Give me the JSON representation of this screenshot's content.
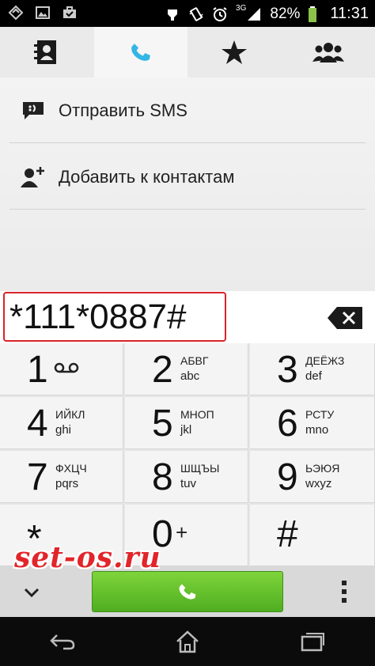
{
  "status_bar": {
    "left_icons": [
      "signal-strength-icon",
      "image-icon",
      "briefcase-icon"
    ],
    "right_icons": [
      "ring-icon",
      "vibrate-icon",
      "alarm-icon",
      "network-3g-icon",
      "battery-icon"
    ],
    "network": "3G",
    "battery": "82%",
    "time": "11:31"
  },
  "tabs": [
    {
      "name": "contacts",
      "icon": "contacts-icon"
    },
    {
      "name": "phone",
      "icon": "phone-icon",
      "active": true
    },
    {
      "name": "favorites",
      "icon": "star-icon"
    },
    {
      "name": "groups",
      "icon": "groups-icon"
    }
  ],
  "actions": {
    "send_sms": "Отправить SMS",
    "add_contact": "Добавить к контактам"
  },
  "dialer": {
    "number": "*111*0887#"
  },
  "keypad": [
    {
      "digit": "1",
      "sub1": "",
      "sub2": ""
    },
    {
      "digit": "2",
      "sub1": "АБВГ",
      "sub2": "abc"
    },
    {
      "digit": "3",
      "sub1": "ДЕЁЖЗ",
      "sub2": "def"
    },
    {
      "digit": "4",
      "sub1": "ИЙКЛ",
      "sub2": "ghi"
    },
    {
      "digit": "5",
      "sub1": "МНОП",
      "sub2": "jkl"
    },
    {
      "digit": "6",
      "sub1": "РСТУ",
      "sub2": "mno"
    },
    {
      "digit": "7",
      "sub1": "ФХЦЧ",
      "sub2": "pqrs"
    },
    {
      "digit": "8",
      "sub1": "ШЩЪЫ",
      "sub2": "tuv"
    },
    {
      "digit": "9",
      "sub1": "ЬЭЮЯ",
      "sub2": "wxyz"
    },
    {
      "digit": "*",
      "sub1": "",
      "sub2": ""
    },
    {
      "digit": "0",
      "sub1": "+",
      "sub2": ""
    },
    {
      "digit": "#",
      "sub1": "",
      "sub2": ""
    }
  ],
  "watermark": "set-os.ru",
  "colors": {
    "call_button": "#5cbf2a",
    "highlight_frame": "#d8232a",
    "watermark": "#e1252a",
    "tab_active_icon": "#33b5e5"
  }
}
